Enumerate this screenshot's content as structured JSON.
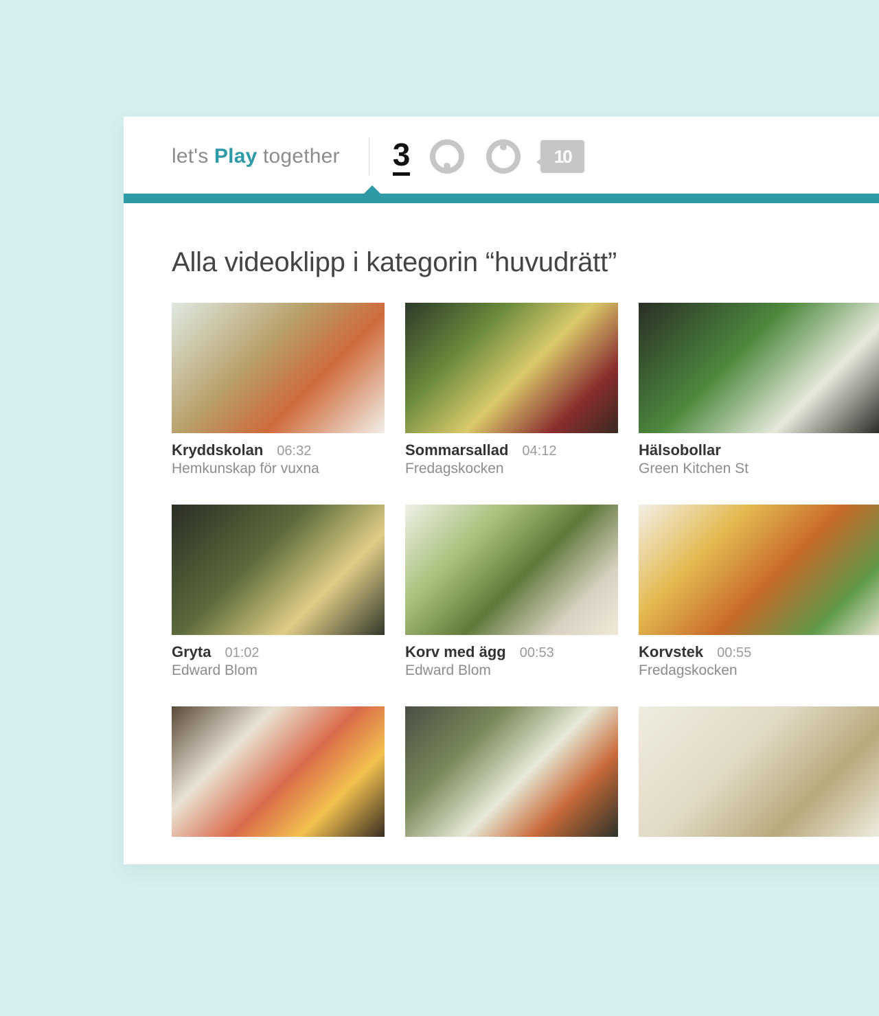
{
  "header": {
    "tagline_pre": "let's ",
    "tagline_play": "Play",
    "tagline_post": " together",
    "channels": [
      {
        "id": "tv3",
        "label": "3",
        "active": true
      },
      {
        "id": "tv6",
        "label": "6",
        "active": false
      },
      {
        "id": "tv8",
        "label": "8",
        "active": false
      },
      {
        "id": "tv10",
        "label": "10",
        "active": false
      }
    ]
  },
  "page": {
    "title": "Alla videoklipp i kategorin “huvudrätt”"
  },
  "clips": [
    {
      "title": "Kryddskolan",
      "duration": "06:32",
      "show": "Hemkunskap för vuxna"
    },
    {
      "title": "Sommarsallad",
      "duration": "04:12",
      "show": "Fredagskocken"
    },
    {
      "title": "Hälsobollar",
      "duration": "",
      "show": "Green Kitchen St"
    },
    {
      "title": "Gryta",
      "duration": "01:02",
      "show": "Edward Blom"
    },
    {
      "title": "Korv med ägg",
      "duration": "00:53",
      "show": "Edward Blom"
    },
    {
      "title": "Korvstek",
      "duration": "00:55",
      "show": "Fredagskocken"
    },
    {
      "title": "",
      "duration": "",
      "show": ""
    },
    {
      "title": "",
      "duration": "",
      "show": ""
    },
    {
      "title": "",
      "duration": "",
      "show": ""
    }
  ],
  "colors": {
    "page_bg": "#d4f0ee",
    "accent": "#2d9aa6",
    "muted": "#8c8c8c"
  }
}
